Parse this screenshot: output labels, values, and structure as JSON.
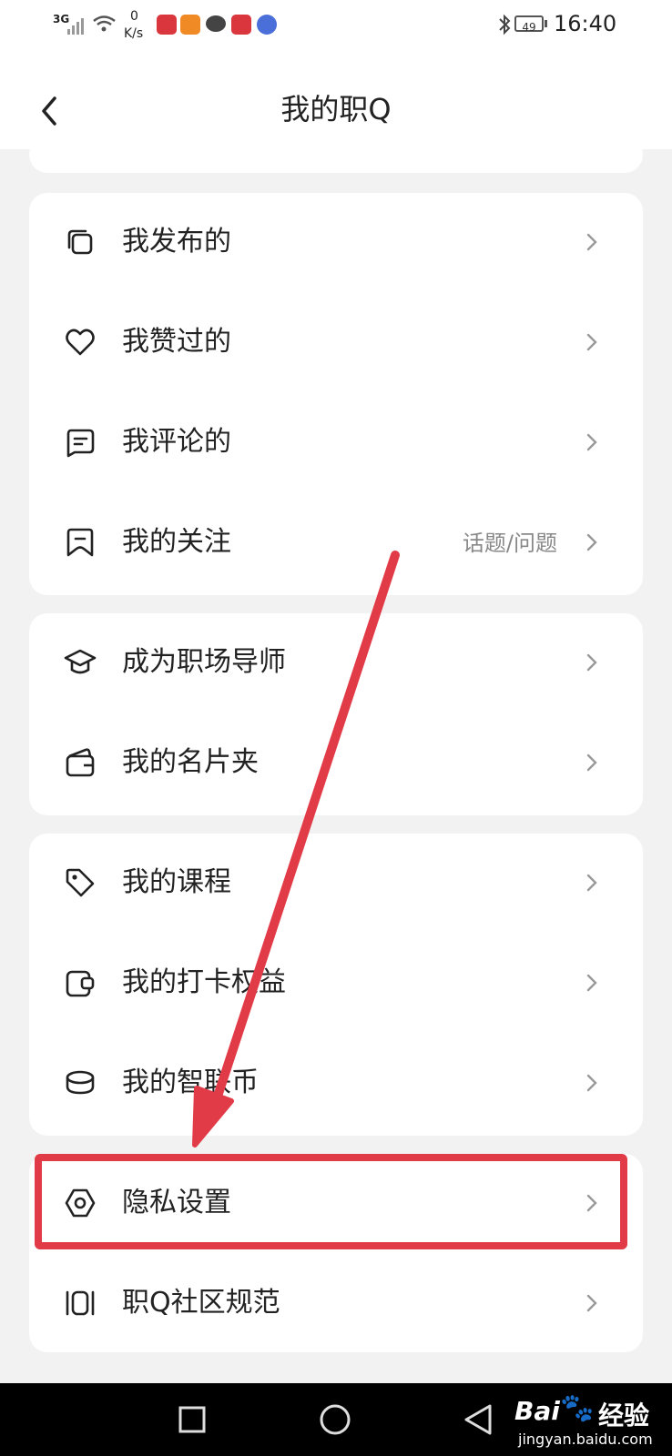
{
  "status_bar": {
    "network": "3G",
    "speed_value": "0",
    "speed_unit": "K/s",
    "battery": "49",
    "time": "16:40"
  },
  "header": {
    "title": "我的职Q"
  },
  "groups": [
    {
      "items": [
        {
          "label": "我发布的",
          "icon": "copy-icon"
        },
        {
          "label": "我赞过的",
          "icon": "heart-icon"
        },
        {
          "label": "我评论的",
          "icon": "comment-icon"
        },
        {
          "label": "我的关注",
          "icon": "bookmark-icon",
          "extra": "话题/问题"
        }
      ]
    },
    {
      "items": [
        {
          "label": "成为职场导师",
          "icon": "graduation-cap-icon"
        },
        {
          "label": "我的名片夹",
          "icon": "wallet-icon"
        }
      ]
    },
    {
      "items": [
        {
          "label": "我的课程",
          "icon": "tag-icon"
        },
        {
          "label": "我的打卡权益",
          "icon": "checkin-icon"
        },
        {
          "label": "我的智联币",
          "icon": "coin-icon"
        }
      ]
    },
    {
      "items": [
        {
          "label": "隐私设置",
          "icon": "privacy-settings-icon"
        },
        {
          "label": "职Q社区规范",
          "icon": "rules-icon"
        }
      ]
    }
  ],
  "watermark": {
    "brand": "Bai",
    "du": "du",
    "jingyan": "经验",
    "url": "jingyan.baidu.com"
  },
  "colors": {
    "accent_annotation": "#e23b48",
    "background": "#f2f2f2",
    "card": "#ffffff",
    "text": "#222222",
    "muted": "#888888"
  }
}
